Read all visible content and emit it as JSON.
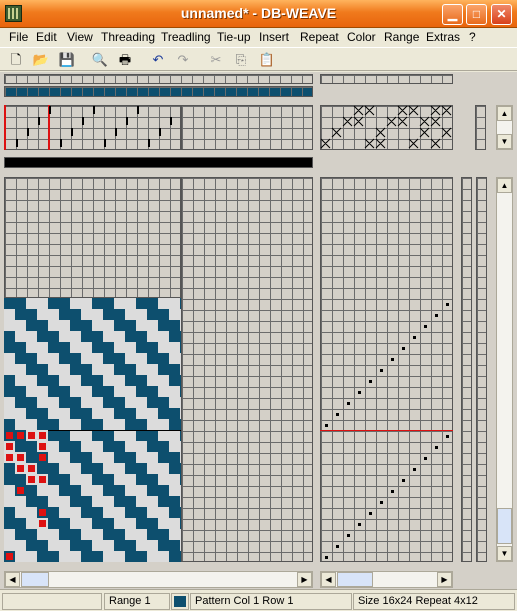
{
  "window": {
    "title": "unnamed* - DB-WEAVE"
  },
  "menu": [
    "File",
    "Edit",
    "View",
    "Threading",
    "Treadling",
    "Tie-up",
    "Insert",
    "Repeat",
    "Color",
    "Range",
    "Extras",
    "?"
  ],
  "toolbar": [
    "new-icon",
    "open-icon",
    "save-icon",
    "print-preview-icon",
    "print-icon",
    "undo-icon",
    "redo-icon",
    "cut-icon",
    "copy-icon",
    "paste-icon"
  ],
  "colors": {
    "warp": "#0d4f6e",
    "weft": "#d9d9d9",
    "range_mark": "#dd1111",
    "title_orange": "#f07a1d"
  },
  "status": {
    "range": "Range 1",
    "pattern": "Pattern  Col 1  Row 1",
    "size": "Size 16x24  Repeat 4x12"
  }
}
